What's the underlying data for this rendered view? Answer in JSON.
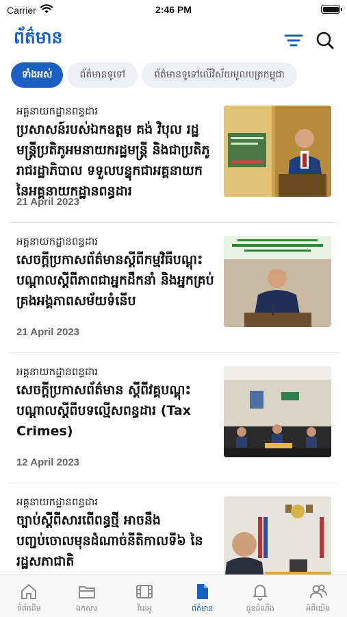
{
  "status": {
    "carrier": "Carrier",
    "time": "2:46 PM"
  },
  "header": {
    "title": "ព័ត៌មាន"
  },
  "tabs": [
    {
      "label": "ទាំងអស់",
      "active": true
    },
    {
      "label": "ព័ត៌មានទូទៅ",
      "active": false
    },
    {
      "label": "ព័ត៌មានទូទៅលើវិស័យមូលបត្រកម្ពុជា",
      "active": false
    }
  ],
  "news": [
    {
      "category": "អគ្គនាយកដ្ឋានពន្ធដារ",
      "title": "ប្រសាសន៍របស់ឯកឧត្តម គង់ វិបុល រដ្ឋមន្ត្រីប្រតិភូអមនាយករដ្ឋមន្ត្រី និងជាប្រតិភូរាជរដ្ឋាភិបាល ទទួលបន្ទុកជាអគ្គនាយកនៃអគ្គនាយកដ្ឋានពន្ធដារ",
      "date": "21 April 2023"
    },
    {
      "category": "អគ្គនាយកដ្ឋានពន្ធដារ",
      "title": "សេចក្តីប្រកាសព័ត៌មានស្តីពីកម្មវិធីបណ្តុះបណ្តាលស្តីពីភាពជាអ្នកដឹកនាំ និងអ្នកគ្រប់គ្រងអង្គភាពសម័យទំនើប",
      "date": "21 April 2023"
    },
    {
      "category": "អគ្គនាយកដ្ឋានពន្ធដារ",
      "title": "សេចក្តីប្រកាសព័ត៌មាន ស្តីពីវគ្គបណ្តុះបណ្តាលស្តីពីបទល្មើសពន្ធដារ (Tax Crimes)",
      "date": "12 April 2023"
    },
    {
      "category": "អគ្គនាយកដ្ឋានពន្ធដារ",
      "title": "ច្បាប់ស្តីពីសារពើពន្ធថ្មី អាចនឹងបញ្ជប់ចោលមុនដំណាច់នីតិកាលទី៦ នៃរដ្ឋសភាជាតិ",
      "date": ""
    }
  ],
  "tab_bar": [
    {
      "label": "ទំព័រដើម",
      "icon": "home-icon",
      "active": false
    },
    {
      "label": "ឯកសារ",
      "icon": "folder-icon",
      "active": false
    },
    {
      "label": "វីដេអូ",
      "icon": "film-icon",
      "active": false
    },
    {
      "label": "ព័ត៌មាន",
      "icon": "document-icon",
      "active": true
    },
    {
      "label": "ជូនដំណឹង",
      "icon": "bell-icon",
      "active": false
    },
    {
      "label": "អំពីយើង",
      "icon": "people-icon",
      "active": false
    }
  ],
  "colors": {
    "accent": "#1a5fc2",
    "inactive": "#8a8a8e"
  }
}
